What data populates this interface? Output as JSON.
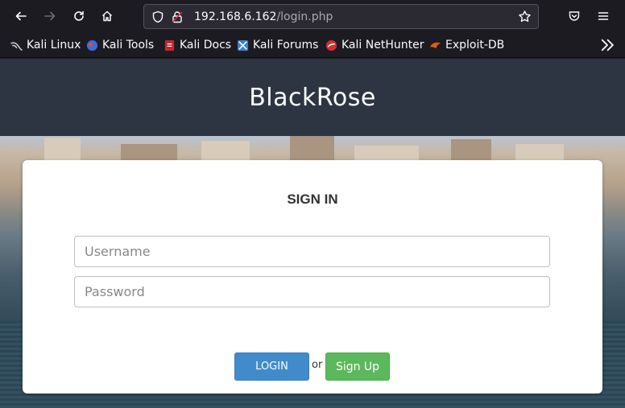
{
  "browser": {
    "url_host": "192.168.6.162",
    "url_path": "/login.php",
    "bookmarks": [
      {
        "label": "Kali Linux",
        "icon": "kali-dragon-icon",
        "color": "#1c1b22"
      },
      {
        "label": "Kali Tools",
        "icon": "kali-tools-icon",
        "color": "#3d6fd6"
      },
      {
        "label": "Kali Docs",
        "icon": "kali-docs-icon",
        "color": "#c4272b"
      },
      {
        "label": "Kali Forums",
        "icon": "kali-forums-icon",
        "color": "#3b82c4"
      },
      {
        "label": "Kali NetHunter",
        "icon": "kali-nethunter-icon",
        "color": "#d32f2f"
      },
      {
        "label": "Exploit-DB",
        "icon": "exploit-db-icon",
        "color": "#e05a10"
      }
    ]
  },
  "page": {
    "brand": "BlackRose",
    "login_form": {
      "title": "SIGN IN",
      "username_placeholder": "Username",
      "password_placeholder": "Password",
      "login_label": "LOGIN",
      "or_text": "or",
      "signup_label": "Sign Up"
    }
  },
  "colors": {
    "header_bg": "#2c3541",
    "login_button": "#428bca",
    "signup_button": "#5cb85c"
  }
}
